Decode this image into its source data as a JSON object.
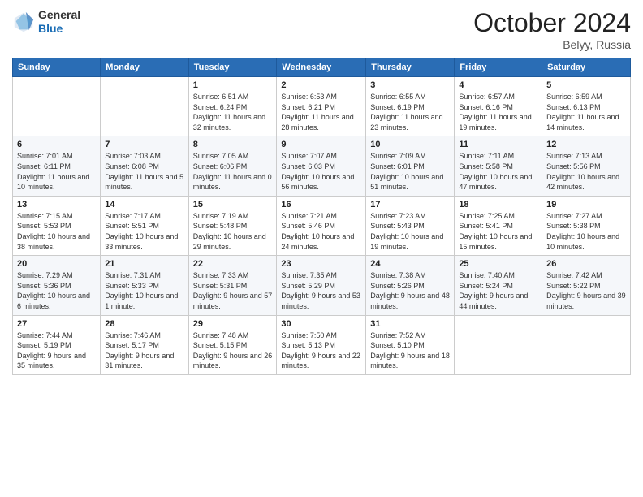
{
  "logo": {
    "general": "General",
    "blue": "Blue"
  },
  "title": "October 2024",
  "location": "Belyy, Russia",
  "days_of_week": [
    "Sunday",
    "Monday",
    "Tuesday",
    "Wednesday",
    "Thursday",
    "Friday",
    "Saturday"
  ],
  "weeks": [
    [
      {
        "day": "",
        "sunrise": "",
        "sunset": "",
        "daylight": ""
      },
      {
        "day": "",
        "sunrise": "",
        "sunset": "",
        "daylight": ""
      },
      {
        "day": "1",
        "sunrise": "Sunrise: 6:51 AM",
        "sunset": "Sunset: 6:24 PM",
        "daylight": "Daylight: 11 hours and 32 minutes."
      },
      {
        "day": "2",
        "sunrise": "Sunrise: 6:53 AM",
        "sunset": "Sunset: 6:21 PM",
        "daylight": "Daylight: 11 hours and 28 minutes."
      },
      {
        "day": "3",
        "sunrise": "Sunrise: 6:55 AM",
        "sunset": "Sunset: 6:19 PM",
        "daylight": "Daylight: 11 hours and 23 minutes."
      },
      {
        "day": "4",
        "sunrise": "Sunrise: 6:57 AM",
        "sunset": "Sunset: 6:16 PM",
        "daylight": "Daylight: 11 hours and 19 minutes."
      },
      {
        "day": "5",
        "sunrise": "Sunrise: 6:59 AM",
        "sunset": "Sunset: 6:13 PM",
        "daylight": "Daylight: 11 hours and 14 minutes."
      }
    ],
    [
      {
        "day": "6",
        "sunrise": "Sunrise: 7:01 AM",
        "sunset": "Sunset: 6:11 PM",
        "daylight": "Daylight: 11 hours and 10 minutes."
      },
      {
        "day": "7",
        "sunrise": "Sunrise: 7:03 AM",
        "sunset": "Sunset: 6:08 PM",
        "daylight": "Daylight: 11 hours and 5 minutes."
      },
      {
        "day": "8",
        "sunrise": "Sunrise: 7:05 AM",
        "sunset": "Sunset: 6:06 PM",
        "daylight": "Daylight: 11 hours and 0 minutes."
      },
      {
        "day": "9",
        "sunrise": "Sunrise: 7:07 AM",
        "sunset": "Sunset: 6:03 PM",
        "daylight": "Daylight: 10 hours and 56 minutes."
      },
      {
        "day": "10",
        "sunrise": "Sunrise: 7:09 AM",
        "sunset": "Sunset: 6:01 PM",
        "daylight": "Daylight: 10 hours and 51 minutes."
      },
      {
        "day": "11",
        "sunrise": "Sunrise: 7:11 AM",
        "sunset": "Sunset: 5:58 PM",
        "daylight": "Daylight: 10 hours and 47 minutes."
      },
      {
        "day": "12",
        "sunrise": "Sunrise: 7:13 AM",
        "sunset": "Sunset: 5:56 PM",
        "daylight": "Daylight: 10 hours and 42 minutes."
      }
    ],
    [
      {
        "day": "13",
        "sunrise": "Sunrise: 7:15 AM",
        "sunset": "Sunset: 5:53 PM",
        "daylight": "Daylight: 10 hours and 38 minutes."
      },
      {
        "day": "14",
        "sunrise": "Sunrise: 7:17 AM",
        "sunset": "Sunset: 5:51 PM",
        "daylight": "Daylight: 10 hours and 33 minutes."
      },
      {
        "day": "15",
        "sunrise": "Sunrise: 7:19 AM",
        "sunset": "Sunset: 5:48 PM",
        "daylight": "Daylight: 10 hours and 29 minutes."
      },
      {
        "day": "16",
        "sunrise": "Sunrise: 7:21 AM",
        "sunset": "Sunset: 5:46 PM",
        "daylight": "Daylight: 10 hours and 24 minutes."
      },
      {
        "day": "17",
        "sunrise": "Sunrise: 7:23 AM",
        "sunset": "Sunset: 5:43 PM",
        "daylight": "Daylight: 10 hours and 19 minutes."
      },
      {
        "day": "18",
        "sunrise": "Sunrise: 7:25 AM",
        "sunset": "Sunset: 5:41 PM",
        "daylight": "Daylight: 10 hours and 15 minutes."
      },
      {
        "day": "19",
        "sunrise": "Sunrise: 7:27 AM",
        "sunset": "Sunset: 5:38 PM",
        "daylight": "Daylight: 10 hours and 10 minutes."
      }
    ],
    [
      {
        "day": "20",
        "sunrise": "Sunrise: 7:29 AM",
        "sunset": "Sunset: 5:36 PM",
        "daylight": "Daylight: 10 hours and 6 minutes."
      },
      {
        "day": "21",
        "sunrise": "Sunrise: 7:31 AM",
        "sunset": "Sunset: 5:33 PM",
        "daylight": "Daylight: 10 hours and 1 minute."
      },
      {
        "day": "22",
        "sunrise": "Sunrise: 7:33 AM",
        "sunset": "Sunset: 5:31 PM",
        "daylight": "Daylight: 9 hours and 57 minutes."
      },
      {
        "day": "23",
        "sunrise": "Sunrise: 7:35 AM",
        "sunset": "Sunset: 5:29 PM",
        "daylight": "Daylight: 9 hours and 53 minutes."
      },
      {
        "day": "24",
        "sunrise": "Sunrise: 7:38 AM",
        "sunset": "Sunset: 5:26 PM",
        "daylight": "Daylight: 9 hours and 48 minutes."
      },
      {
        "day": "25",
        "sunrise": "Sunrise: 7:40 AM",
        "sunset": "Sunset: 5:24 PM",
        "daylight": "Daylight: 9 hours and 44 minutes."
      },
      {
        "day": "26",
        "sunrise": "Sunrise: 7:42 AM",
        "sunset": "Sunset: 5:22 PM",
        "daylight": "Daylight: 9 hours and 39 minutes."
      }
    ],
    [
      {
        "day": "27",
        "sunrise": "Sunrise: 7:44 AM",
        "sunset": "Sunset: 5:19 PM",
        "daylight": "Daylight: 9 hours and 35 minutes."
      },
      {
        "day": "28",
        "sunrise": "Sunrise: 7:46 AM",
        "sunset": "Sunset: 5:17 PM",
        "daylight": "Daylight: 9 hours and 31 minutes."
      },
      {
        "day": "29",
        "sunrise": "Sunrise: 7:48 AM",
        "sunset": "Sunset: 5:15 PM",
        "daylight": "Daylight: 9 hours and 26 minutes."
      },
      {
        "day": "30",
        "sunrise": "Sunrise: 7:50 AM",
        "sunset": "Sunset: 5:13 PM",
        "daylight": "Daylight: 9 hours and 22 minutes."
      },
      {
        "day": "31",
        "sunrise": "Sunrise: 7:52 AM",
        "sunset": "Sunset: 5:10 PM",
        "daylight": "Daylight: 9 hours and 18 minutes."
      },
      {
        "day": "",
        "sunrise": "",
        "sunset": "",
        "daylight": ""
      },
      {
        "day": "",
        "sunrise": "",
        "sunset": "",
        "daylight": ""
      }
    ]
  ]
}
